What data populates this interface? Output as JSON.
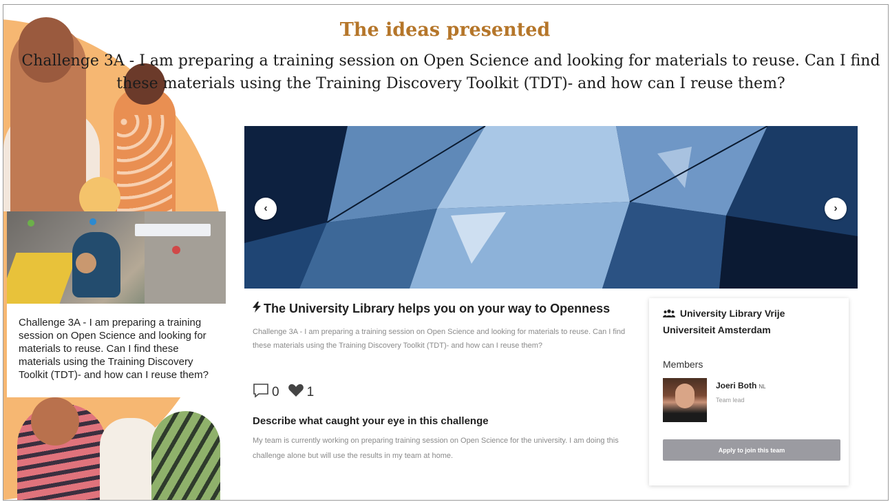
{
  "slide": {
    "title": "The ideas presented",
    "subtitle": "Challenge 3A - I am preparing a training session on Open Science and looking for materials to reuse. Can I find these materials using the Training Discovery Toolkit (TDT)- and how can I reuse them?"
  },
  "challenge_card": {
    "text": "Challenge 3A - I am preparing a training session on Open Science and looking for materials to reuse. Can I find these materials using the Training Discovery Toolkit (TDT)- and how can I reuse them?"
  },
  "carousel": {
    "prev_icon": "‹",
    "next_icon": "›"
  },
  "idea": {
    "bolt_icon": "⚡",
    "title": "The University Library helps you on your way to Openness",
    "description": "Challenge 3A - I am preparing a training session on Open Science and looking for materials to reuse. Can I find these materials using the Training Discovery Toolkit (TDT)- and how can I reuse them?",
    "comments_count": "0",
    "likes_count": "1",
    "eye_heading": "Describe what caught your eye in this challenge",
    "eye_text": "My team is currently working on preparing training session on Open Science for the university. I am doing this challenge alone but will use the results in my team at home."
  },
  "team": {
    "name": "University Library Vrije Universiteit Amsterdam",
    "members_heading": "Members",
    "member": {
      "name": "Joeri Both",
      "country": "NL",
      "role": "Team lead"
    },
    "apply_label": "Apply to join this team"
  },
  "colors": {
    "title": "#b5762a",
    "apply_button": "#9b9ba1",
    "muted_text": "#8a8a8a"
  }
}
